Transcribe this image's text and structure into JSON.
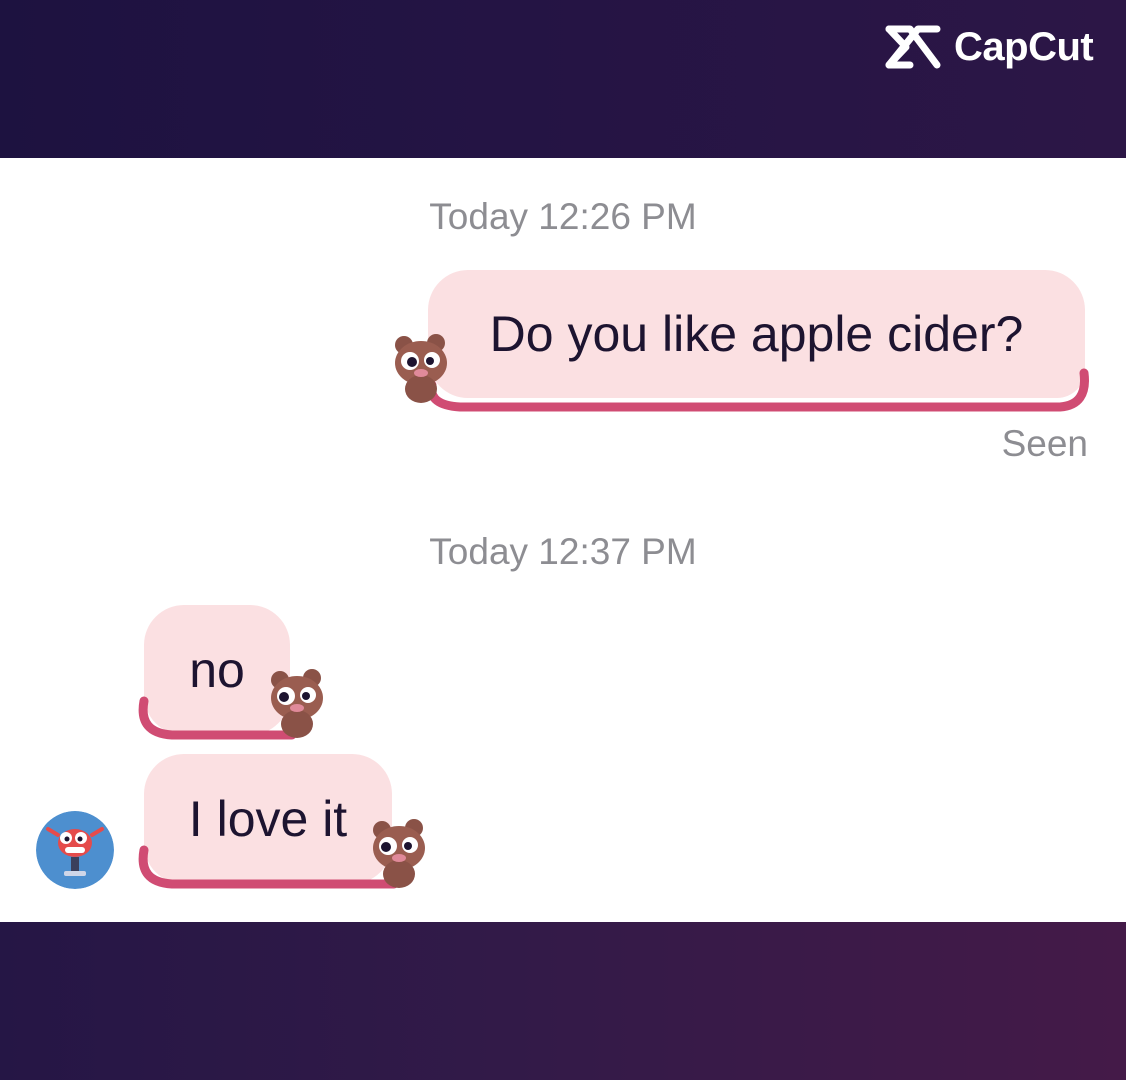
{
  "watermark": {
    "label": "CapCut",
    "icon": "capcut-logo-icon"
  },
  "chat": {
    "groups": [
      {
        "timestamp": "Today 12:26 PM",
        "messages": [
          {
            "direction": "outgoing",
            "text": "Do you like apple cider?",
            "sticker": "bear-sticker-icon"
          }
        ],
        "status": "Seen"
      },
      {
        "timestamp": "Today 12:37 PM",
        "messages": [
          {
            "direction": "incoming",
            "text": "no",
            "sticker": "bear-sticker-icon"
          },
          {
            "direction": "incoming",
            "text": "I love it",
            "sticker": "bear-sticker-icon"
          }
        ]
      }
    ],
    "avatar_icon": "cartoon-avatar-icon"
  },
  "colors": {
    "band_top": "#1d1240",
    "band_bottom": "#441a48",
    "bubble_fill": "#fbe0e2",
    "bubble_tail": "#d04c73",
    "timestamp_text": "#8d8d92",
    "message_text": "#1d1430"
  }
}
